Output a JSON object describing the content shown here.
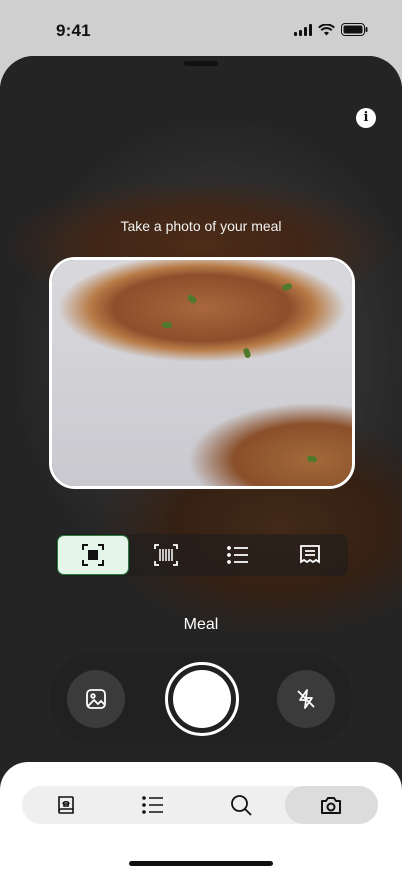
{
  "status_bar": {
    "time": "9:41"
  },
  "camera": {
    "hint": "Take a photo of your meal",
    "mode_label": "Meal",
    "modes": [
      {
        "icon": "scan-frame-icon",
        "active": true
      },
      {
        "icon": "barcode-icon",
        "active": false
      },
      {
        "icon": "list-icon",
        "active": false
      },
      {
        "icon": "receipt-icon",
        "active": false
      }
    ],
    "controls": {
      "left": "image-icon",
      "right": "flash-off-icon"
    }
  },
  "tabs": [
    {
      "icon": "recipe-book-icon",
      "active": false
    },
    {
      "icon": "list-icon",
      "active": false
    },
    {
      "icon": "search-icon",
      "active": false
    },
    {
      "icon": "camera-icon",
      "active": true
    }
  ],
  "colors": {
    "accent": "#2a7d3d",
    "accent_bg": "#e6f5ea"
  }
}
